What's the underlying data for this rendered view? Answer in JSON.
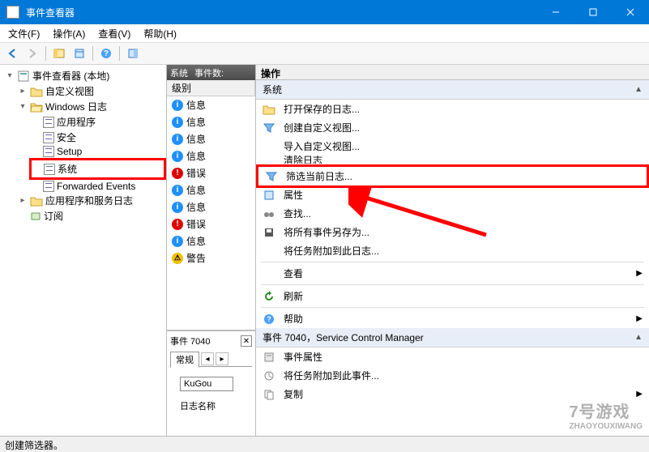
{
  "window": {
    "title": "事件查看器",
    "statusbar": "创建筛选器。"
  },
  "menus": {
    "file": "文件(F)",
    "action": "操作(A)",
    "view": "查看(V)",
    "help": "帮助(H)"
  },
  "tree": {
    "root": "事件查看器 (本地)",
    "custom_views": "自定义视图",
    "windows_logs": "Windows 日志",
    "logs": {
      "application": "应用程序",
      "security": "安全",
      "setup": "Setup",
      "system": "系统",
      "forwarded": "Forwarded Events"
    },
    "app_service_logs": "应用程序和服务日志",
    "subscriptions": "订阅"
  },
  "center": {
    "header_name": "系统",
    "header_count_label": "事件数:",
    "col_level": "级别",
    "rows": [
      {
        "lvl": "info",
        "text": "信息"
      },
      {
        "lvl": "info",
        "text": "信息"
      },
      {
        "lvl": "info",
        "text": "信息"
      },
      {
        "lvl": "info",
        "text": "信息"
      },
      {
        "lvl": "err",
        "text": "错误"
      },
      {
        "lvl": "info",
        "text": "信息"
      },
      {
        "lvl": "info",
        "text": "信息"
      },
      {
        "lvl": "err",
        "text": "错误"
      },
      {
        "lvl": "info",
        "text": "信息"
      },
      {
        "lvl": "warn",
        "text": "警告"
      }
    ],
    "detail_title": "事件 7040",
    "tab_general": "常规",
    "field_value": "KuGou",
    "log_name_label": "日志名称"
  },
  "actions": {
    "header": "操作",
    "group_system": "系统",
    "open_saved_log": "打开保存的日志...",
    "create_custom_view": "创建自定义视图...",
    "import_custom_view": "导入自定义视图...",
    "clear_log": "清除日志",
    "filter_current": "筛选当前日志...",
    "properties": "属性",
    "find": "查找...",
    "save_all_as": "将所有事件另存为...",
    "attach_task_log": "将任务附加到此日志...",
    "view": "查看",
    "refresh": "刷新",
    "help": "帮助",
    "group_event": "事件 7040，Service Control Manager",
    "event_properties": "事件属性",
    "attach_task_event": "将任务附加到此事件...",
    "copy": "复制"
  }
}
